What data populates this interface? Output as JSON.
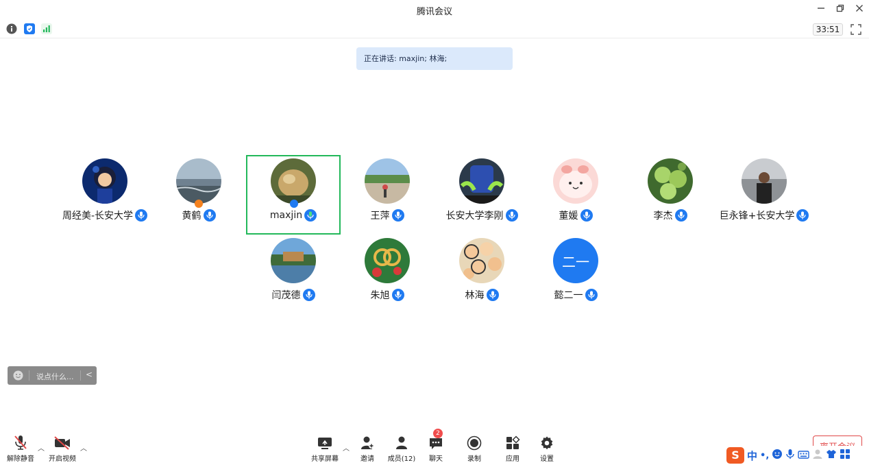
{
  "window": {
    "title": "腾讯会议",
    "minimize_icon": "minimize-icon",
    "restore_icon": "restore-icon",
    "close_icon": "close-icon"
  },
  "status": {
    "timer": "33:51",
    "icons": [
      "info-icon",
      "shield-icon",
      "signal-icon",
      "fullscreen-icon"
    ]
  },
  "speaking_banner": {
    "text": "正在讲话: maxjin; 林海;"
  },
  "participants": [
    {
      "name": "周经美-长安大学"
    },
    {
      "name": "黄鹤"
    },
    {
      "name": "maxjin"
    },
    {
      "name": "王萍"
    },
    {
      "name": "长安大学李刚"
    },
    {
      "name": "董媛"
    },
    {
      "name": "李杰"
    },
    {
      "name": "巨永锋+长安大学"
    },
    {
      "name": "闫茂德"
    },
    {
      "name": "朱旭"
    },
    {
      "name": "林海"
    },
    {
      "name": "懿二一",
      "avatar_text": "二一"
    }
  ],
  "chat": {
    "placeholder": "说点什么...",
    "collapse": "<"
  },
  "toolbar": {
    "unmute": "解除静音",
    "video": "开启视频",
    "share": "共享屏幕",
    "invite": "邀请",
    "members": "成员(12)",
    "chat": "聊天",
    "chat_badge": "2",
    "record": "录制",
    "apps": "应用",
    "settings": "设置",
    "leave": "离开会议"
  },
  "ime": {
    "logo": "S",
    "mode": "中",
    "punct": "•,"
  },
  "colors": {
    "accent": "#1f7af1",
    "active_border": "#22b85a",
    "banner_bg": "#dbe9fb",
    "leave": "#e04848"
  }
}
